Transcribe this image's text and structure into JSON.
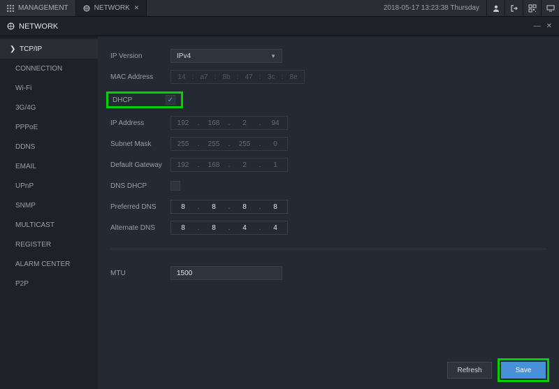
{
  "topbar": {
    "tabs": [
      {
        "label": "MANAGEMENT"
      },
      {
        "label": "NETWORK",
        "closable": true
      }
    ],
    "datetime": "2018-05-17 13:23:38 Thursday"
  },
  "subheader": {
    "title": "NETWORK",
    "minimize": "—",
    "close": "✕"
  },
  "sidebar": {
    "items": [
      {
        "label": "TCP/IP",
        "active": true
      },
      {
        "label": "CONNECTION"
      },
      {
        "label": "Wi-Fi"
      },
      {
        "label": "3G/4G"
      },
      {
        "label": "PPPoE"
      },
      {
        "label": "DDNS"
      },
      {
        "label": "EMAIL"
      },
      {
        "label": "UPnP"
      },
      {
        "label": "SNMP"
      },
      {
        "label": "MULTICAST"
      },
      {
        "label": "REGISTER"
      },
      {
        "label": "ALARM CENTER"
      },
      {
        "label": "P2P"
      }
    ]
  },
  "form": {
    "ip_version_label": "IP Version",
    "ip_version_value": "IPv4",
    "mac_label": "MAC Address",
    "mac": [
      "14",
      "a7",
      "8b",
      "47",
      "3c",
      "8e"
    ],
    "dhcp_label": "DHCP",
    "dhcp_checked": true,
    "ip_label": "IP Address",
    "ip": [
      "192",
      "168",
      "2",
      "94"
    ],
    "subnet_label": "Subnet Mask",
    "subnet": [
      "255",
      "255",
      "255",
      "0"
    ],
    "gateway_label": "Default Gateway",
    "gateway": [
      "192",
      "168",
      "2",
      "1"
    ],
    "dns_dhcp_label": "DNS DHCP",
    "dns_dhcp_checked": false,
    "pref_dns_label": "Preferred DNS",
    "pref_dns": [
      "8",
      "8",
      "8",
      "8"
    ],
    "alt_dns_label": "Alternate DNS",
    "alt_dns": [
      "8",
      "8",
      "4",
      "4"
    ],
    "mtu_label": "MTU",
    "mtu_value": "1500"
  },
  "footer": {
    "refresh": "Refresh",
    "save": "Save"
  }
}
